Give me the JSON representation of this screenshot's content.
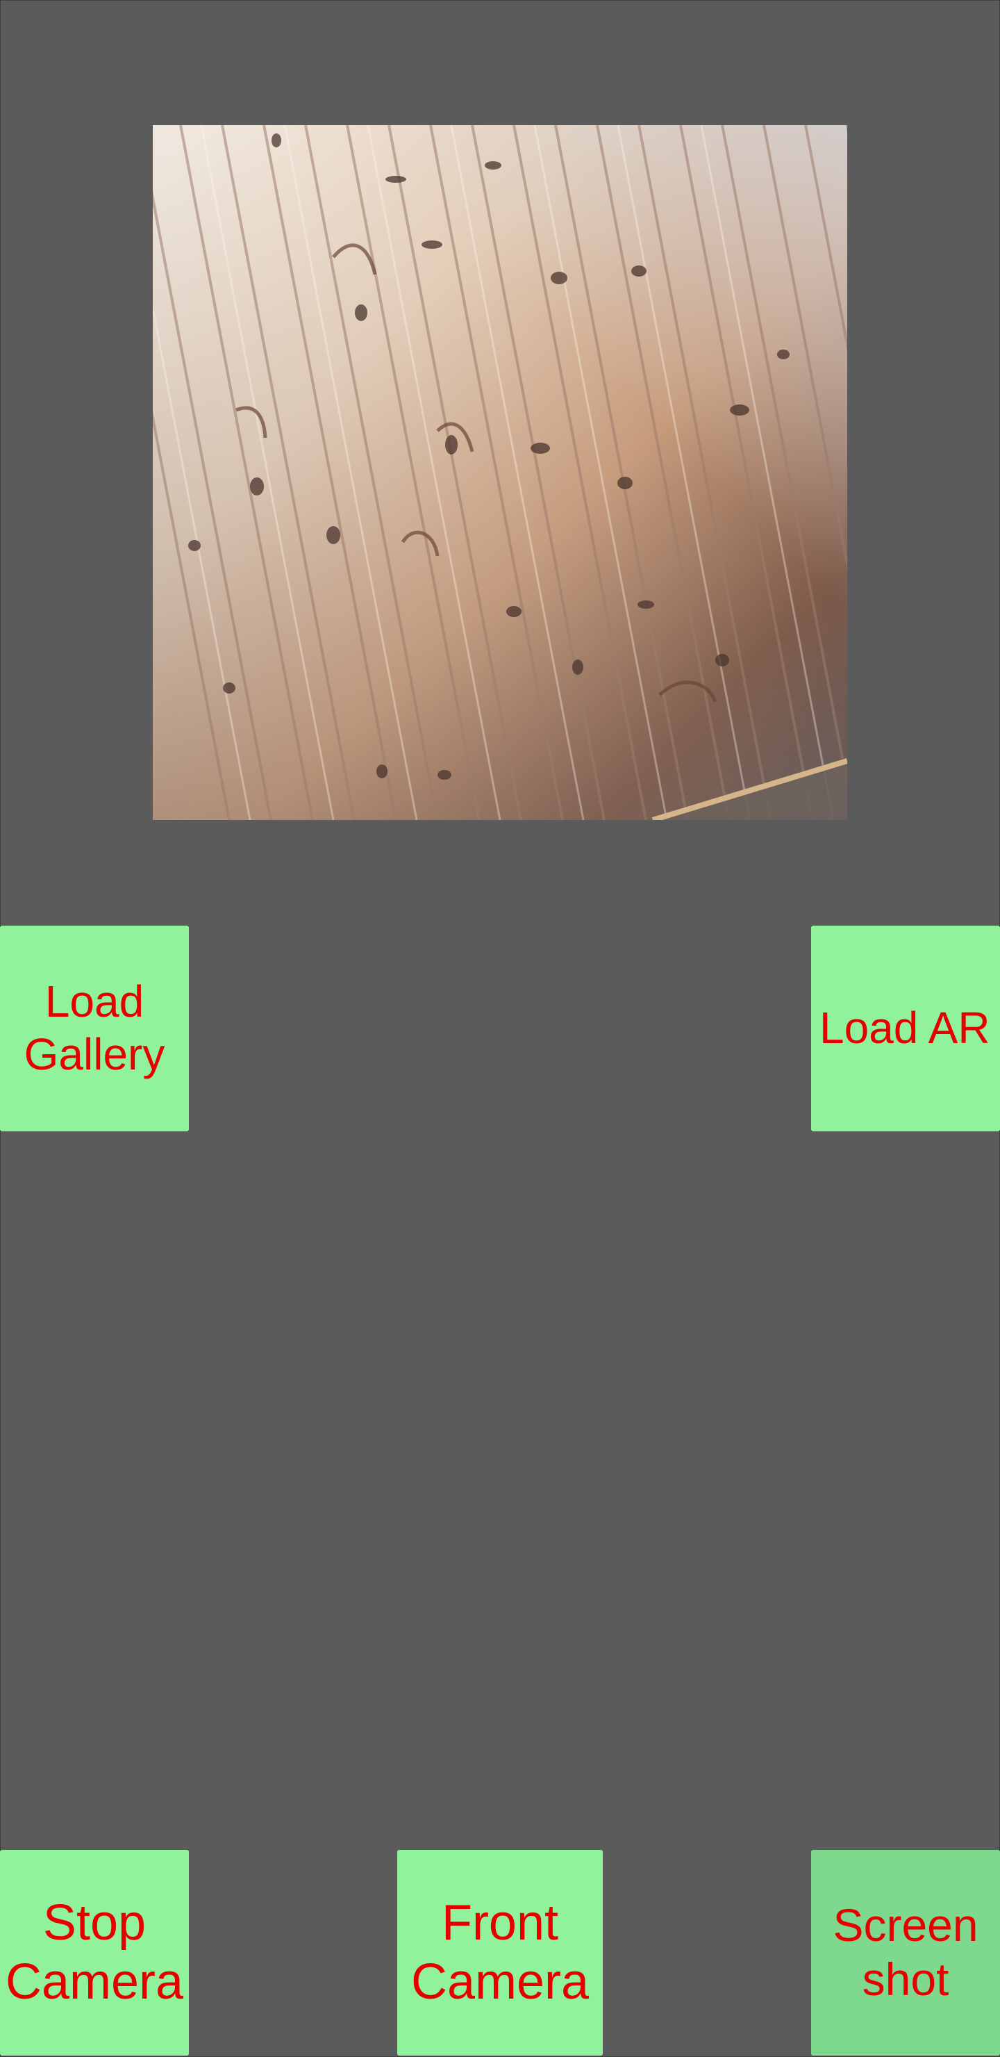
{
  "buttons": {
    "load_gallery": "Load\nGallery",
    "load_ar": "Load AR",
    "stop_camera": "Stop\nCamera",
    "front_camera": "Front\nCamera",
    "screenshot": "Screen\nshot"
  },
  "colors": {
    "background": "#5b5b5b",
    "button_bg": "#90f39c",
    "button_pressed_bg": "#7ed88d",
    "button_text": "#e60000"
  },
  "camera_preview": {
    "content": "wood-panel-ceiling"
  }
}
